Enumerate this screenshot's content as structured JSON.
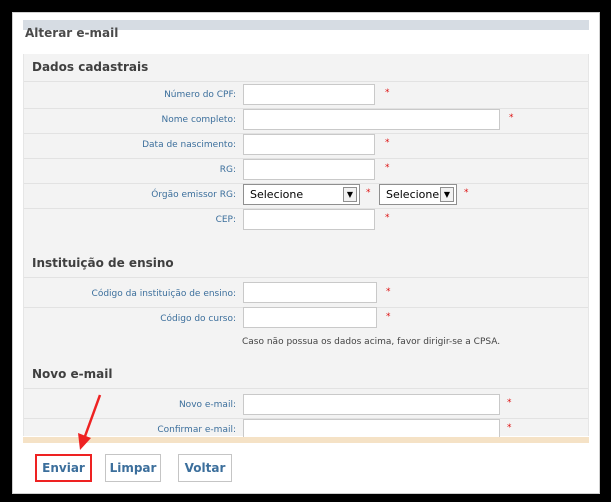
{
  "panel": {
    "title": "Alterar e-mail"
  },
  "sections": {
    "personal": {
      "title": "Dados cadastrais",
      "fields": {
        "cpf": {
          "label": "Número do CPF:",
          "value": "",
          "required": "*"
        },
        "full_name": {
          "label": "Nome completo:",
          "value": "",
          "required": "*"
        },
        "birth_date": {
          "label": "Data de nascimento:",
          "value": "",
          "required": "*"
        },
        "rg": {
          "label": "RG:",
          "value": "",
          "required": "*"
        },
        "rg_issuer": {
          "label": "Órgão emissor RG:",
          "select1": "Selecione",
          "select2": "Selecione",
          "required1": "*",
          "required2": "*"
        },
        "cep": {
          "label": "CEP:",
          "value": "",
          "required": "*"
        }
      }
    },
    "institution": {
      "title": "Instituição de ensino",
      "fields": {
        "institution_code": {
          "label": "Código da instituição de ensino:",
          "value": "",
          "required": "*"
        },
        "course_code": {
          "label": "Código do curso:",
          "value": "",
          "required": "*"
        }
      },
      "note": "Caso não possua os dados acima, favor dirigir-se a CPSA."
    },
    "new_email": {
      "title": "Novo e-mail",
      "fields": {
        "new_email": {
          "label": "Novo e-mail:",
          "value": "",
          "required": "*"
        },
        "confirm_email": {
          "label": "Confirmar e-mail:",
          "value": "",
          "required": "*"
        }
      }
    }
  },
  "actions": {
    "submit": "Enviar",
    "clear": "Limpar",
    "back": "Voltar"
  },
  "colors": {
    "label": "#3c6f9c",
    "required": "#dd1111",
    "highlight": "#e22222"
  }
}
